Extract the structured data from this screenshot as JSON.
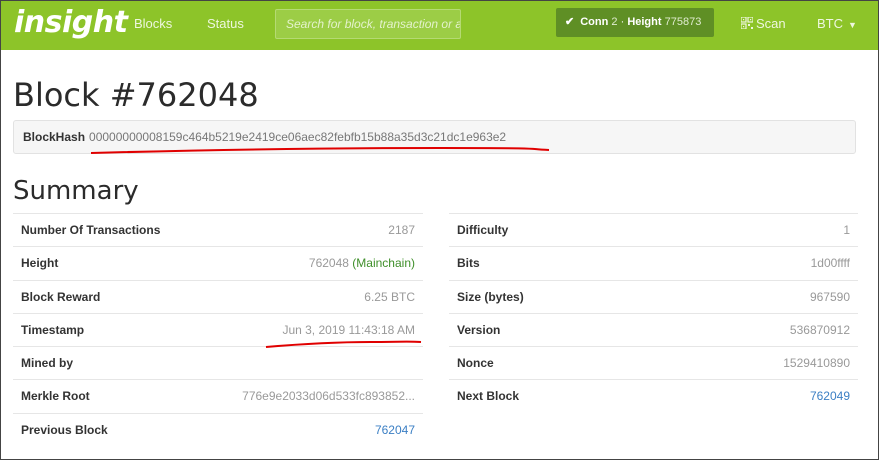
{
  "nav": {
    "brand": "insight",
    "blocks": "Blocks",
    "status": "Status",
    "search_placeholder": "Search for block, transaction or address",
    "conn_label": "Conn",
    "conn_value": "2",
    "height_label": "Height",
    "height_value": "775873",
    "scan": "Scan",
    "currency": "BTC"
  },
  "block": {
    "title": "Block #762048",
    "hash_label": "BlockHash",
    "hash_value": "00000000008159c464b5219e2419ce06aec82febfb15b88a35d3c21dc1e963e2"
  },
  "summary": {
    "title": "Summary",
    "left": [
      {
        "key": "Number Of Transactions",
        "value": "2187"
      },
      {
        "key": "Height",
        "value": "762048",
        "extra": "(Mainchain)"
      },
      {
        "key": "Block Reward",
        "value": "6.25 BTC"
      },
      {
        "key": "Timestamp",
        "value": "Jun 3, 2019 11:43:18 AM"
      },
      {
        "key": "Mined by",
        "value": ""
      },
      {
        "key": "Merkle Root",
        "value": "776e9e2033d06d533fc893852..."
      },
      {
        "key": "Previous Block",
        "value": "762047"
      }
    ],
    "right": [
      {
        "key": "Difficulty",
        "value": "1"
      },
      {
        "key": "Bits",
        "value": "1d00ffff"
      },
      {
        "key": "Size (bytes)",
        "value": "967590"
      },
      {
        "key": "Version",
        "value": "536870912"
      },
      {
        "key": "Nonce",
        "value": "1529410890"
      },
      {
        "key": "Next Block",
        "value": "762049"
      }
    ]
  },
  "colors": {
    "navbar": "#8dc429",
    "status_pill": "#5f8f25",
    "link": "#3b7fc4",
    "annotation": "#e00000"
  }
}
